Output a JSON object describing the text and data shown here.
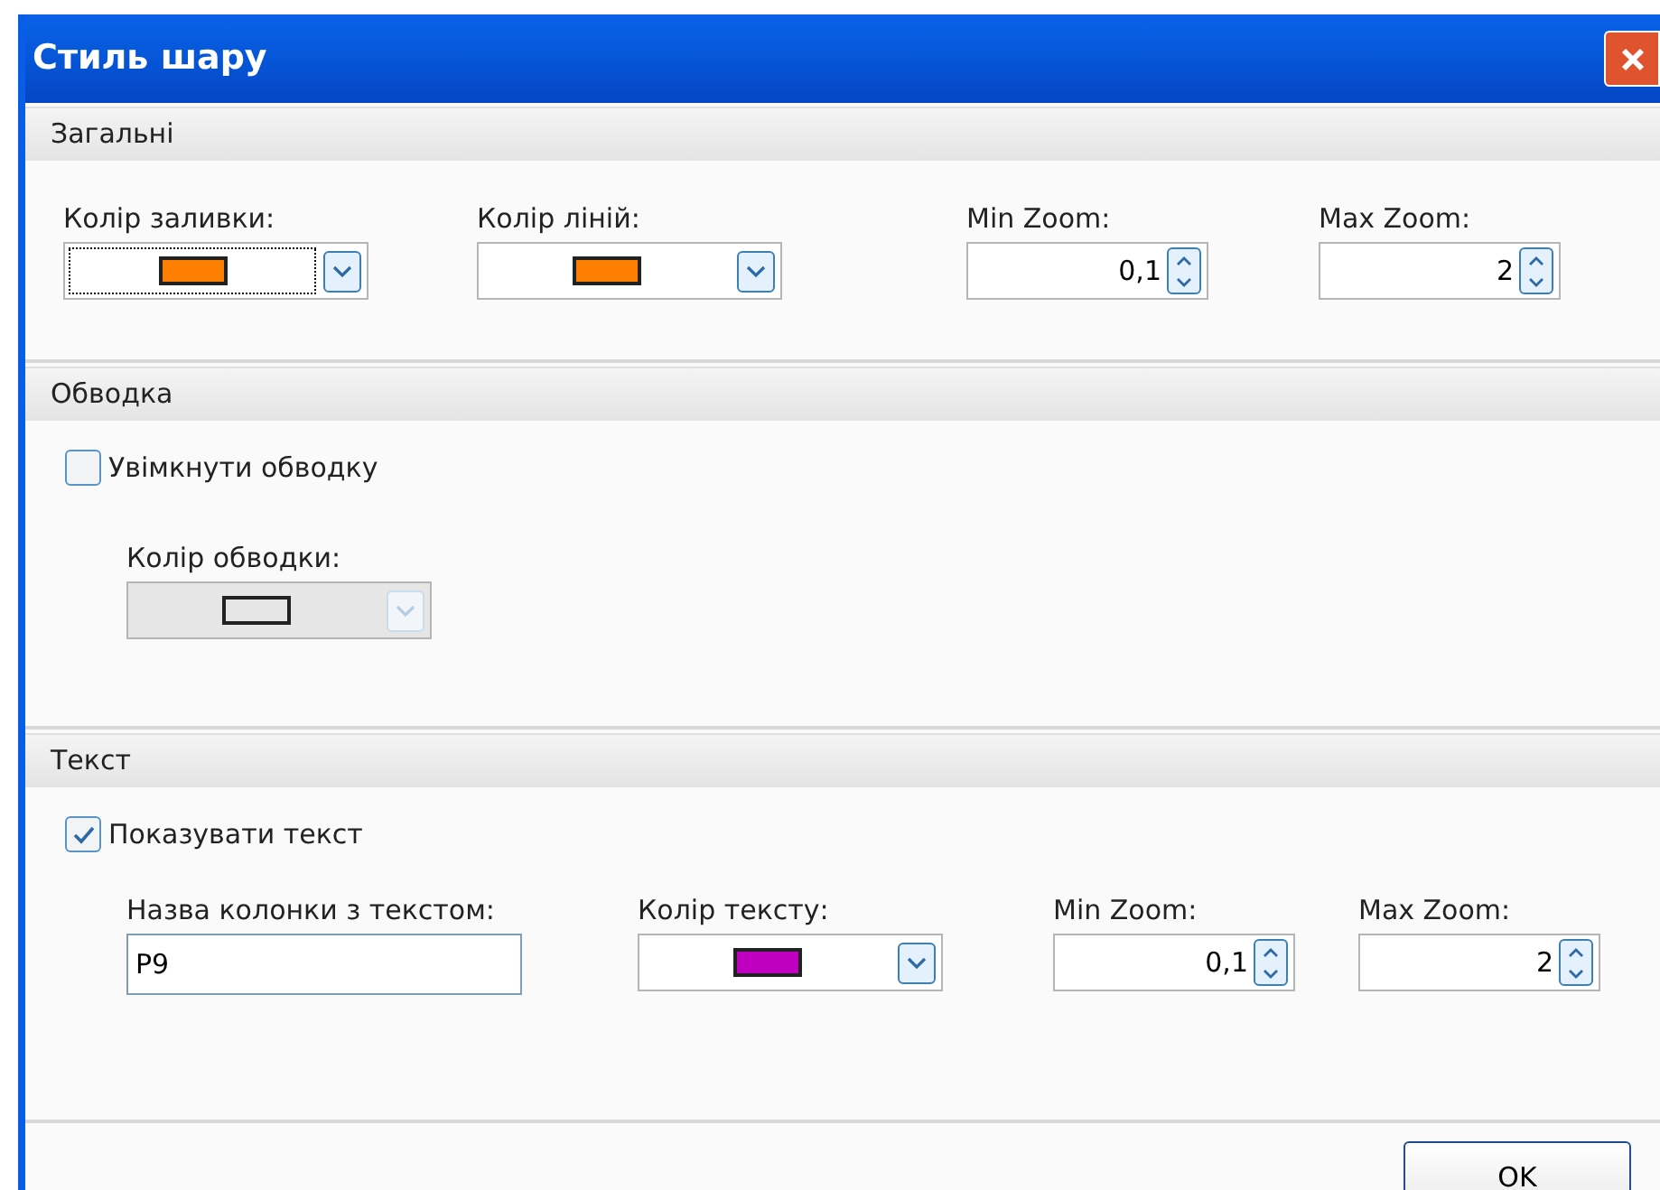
{
  "window": {
    "title": "Стиль шару"
  },
  "sections": [
    {
      "title": "Загальні",
      "fields": [
        {
          "kind": "color",
          "label": "Колір заливки:",
          "color": "#ff8000",
          "focused": true,
          "disabled": false
        },
        {
          "kind": "color",
          "label": "Колір ліній:",
          "color": "#ff8000",
          "focused": false,
          "disabled": false
        },
        {
          "kind": "spin",
          "label": "Min Zoom:",
          "value": "0,1"
        },
        {
          "kind": "spin",
          "label": "Max Zoom:",
          "value": "2"
        }
      ]
    },
    {
      "title": "Обводка",
      "checkbox": {
        "label": "Увімкнути обводку",
        "checked": false
      },
      "fields": [
        {
          "kind": "color",
          "label": "Колір обводки:",
          "color": "#e6e6e6",
          "focused": false,
          "disabled": true
        }
      ]
    },
    {
      "title": "Текст",
      "checkbox": {
        "label": "Показувати текст",
        "checked": true
      },
      "fields": [
        {
          "kind": "text",
          "label": "Назва колонки з текстом:",
          "value": "P9"
        },
        {
          "kind": "color",
          "label": "Колір тексту:",
          "color": "#c000c0",
          "focused": false,
          "disabled": false
        },
        {
          "kind": "spin",
          "label": "Min Zoom:",
          "value": "0,1"
        },
        {
          "kind": "spin",
          "label": "Max Zoom:",
          "value": "2"
        }
      ]
    }
  ],
  "buttons": [
    {
      "label": "OK"
    }
  ]
}
